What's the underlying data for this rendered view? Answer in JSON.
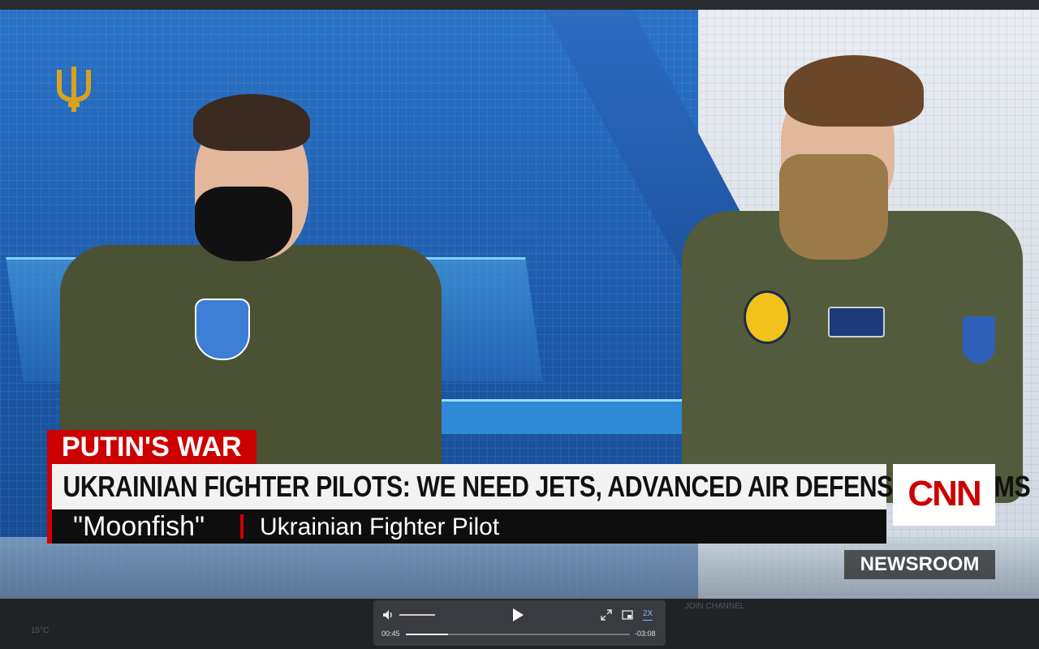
{
  "broadcast": {
    "chyron_tag": "PUTIN'S WAR",
    "headline": "UKRAINIAN FIGHTER PILOTS: WE NEED JETS, ADVANCED AIR DEFENSE SYSTEMS",
    "speaker_name": "\"Moonfish\"",
    "speaker_role": "Ukrainian Fighter Pilot",
    "network_logo": "CNN",
    "show_name": "NEWSROOM"
  },
  "background_text": {
    "join_channel": "JOIN CHANNEL",
    "taskbar_weather": "15°C"
  },
  "player": {
    "current_time": "00:45",
    "remaining_time": "-03:08",
    "speed_label": "2X",
    "progress_fraction": 0.19,
    "volume_fraction": 1.0
  },
  "icons": {
    "logo": "trident-logo-icon",
    "volume": "volume-icon",
    "play": "play-icon",
    "expand": "expand-icon",
    "pip": "picture-in-picture-icon"
  },
  "colors": {
    "cnn_red": "#cc0000",
    "chyron_bg": "#f2f2f2",
    "subbar_bg": "#0e0e0e",
    "studio_blue": "#1b58a8"
  }
}
